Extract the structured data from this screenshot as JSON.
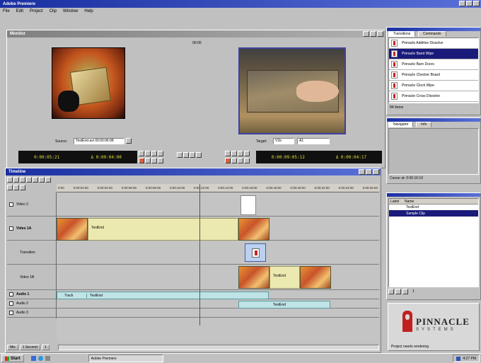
{
  "app": {
    "title": "Adobe Premiere"
  },
  "menu": [
    "File",
    "Edit",
    "Project",
    "Clip",
    "Window",
    "Help"
  ],
  "monitor": {
    "title": "Monitor",
    "center_label": "00:00",
    "source_label": "Source:",
    "source_value": "TestEnd.avi  00:00:06:08",
    "target_label": "Target:",
    "target_value_1": "V1b",
    "target_value_2": "A1",
    "tc_src_in": "0:00:05:21",
    "tc_src_out": "Δ 0:00:04:00",
    "tc_prog_in": "0:00:09:05:12",
    "tc_prog_out": "Δ 0:00:04:17"
  },
  "transitions": {
    "tabs": [
      "Transitions",
      "Commands"
    ],
    "items": [
      "Pinnacle Additive Dissolve",
      "Pinnacle Band Wipe",
      "Pinnacle Barn Doors",
      "Pinnacle Checker Board",
      "Pinnacle Clock Wipe",
      "Pinnacle Cross Dissolve"
    ],
    "selected_index": 1,
    "footer": "84 Items"
  },
  "navigator": {
    "tabs": [
      "Navigator",
      "Info"
    ],
    "status": "Cursor at: 0:00:16:10"
  },
  "project": {
    "col_name": "Name",
    "col_label": "Label",
    "clip_name": "TestEnd",
    "selected_item": "Sample Clip",
    "zoom_label": "1"
  },
  "logo": {
    "brand": "PINNACLE",
    "sub": "SYSTEMS",
    "status": "Project needs rendering"
  },
  "timeline": {
    "title": "Timeline",
    "ruler": [
      "0:00",
      "0:00:02:00",
      "0:00:04:00",
      "0:00:06:00",
      "0:00:08:00",
      "0:00:10:00",
      "0:00:12:00",
      "0:00:14:00",
      "0:00:16:00",
      "0:00:18:00",
      "0:00:20:00",
      "0:00:22:00",
      "0:00:24:00",
      "0:00:26:00",
      "0:00:28:00"
    ],
    "tracks": {
      "video2": "Video 2",
      "video1a": "Video 1A",
      "transition": "Transition",
      "video1b": "Video 1B",
      "audio1": "Audio 1",
      "audio2": "Audio 2",
      "audio3": "Audio 3"
    },
    "clip_label": "TestEnd",
    "audio_clip_small": "Track",
    "bottom_zoom": "1 Second",
    "bottom_buttons": [
      "Mix",
      "1"
    ]
  },
  "taskbar": {
    "start": "Start",
    "app_button": "Adobe Premiere",
    "clock": "4:27 PM"
  }
}
